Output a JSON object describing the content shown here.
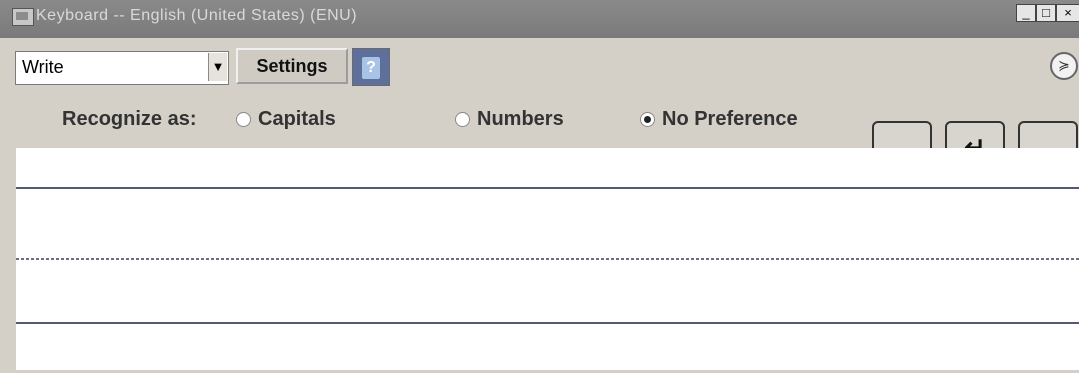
{
  "window": {
    "title": "Keyboard -- English (United States) (ENU)",
    "controls": {
      "minimize": "_",
      "maximize": "□",
      "close": "×"
    }
  },
  "toolbar": {
    "mode_value": "Write",
    "settings_label": "Settings",
    "help_icon": "help-icon",
    "collapse_icon": "chevron-down-icon"
  },
  "recognize": {
    "label": "Recognize as:",
    "options": [
      {
        "label": "Capitals",
        "selected": false
      },
      {
        "label": "Numbers",
        "selected": false
      },
      {
        "label": "No Preference",
        "selected": true
      }
    ]
  },
  "keys": {
    "space": "␣",
    "enter": "↵",
    "backspace": "←"
  },
  "colors": {
    "window_bg": "#d4d0c8",
    "titlebar": "#7a7a7a",
    "guideline": "#555a73"
  }
}
